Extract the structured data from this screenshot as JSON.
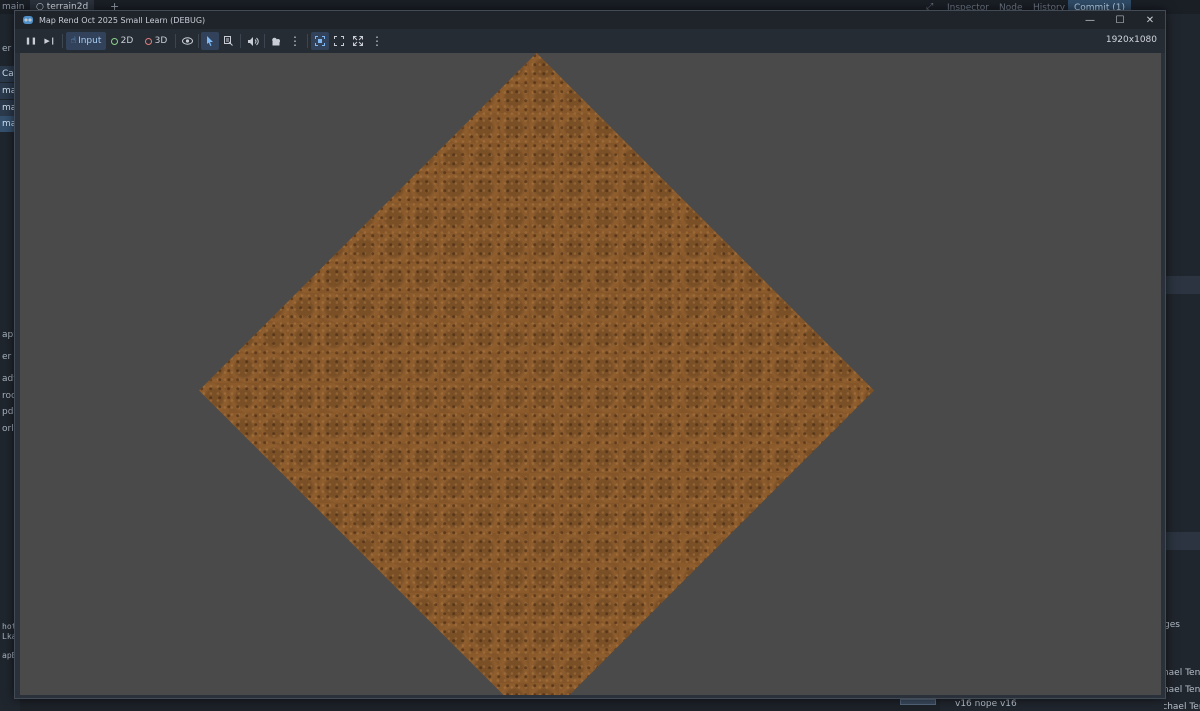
{
  "editor": {
    "tabs": [
      "main",
      "terrain2d"
    ],
    "add_tab": "+",
    "right_tabs": [
      "Inspector",
      "Node",
      "History",
      "Commit (1)"
    ],
    "left_items": [
      "er Si",
      "Can",
      "mai",
      "map",
      "map",
      "apStr",
      "er M",
      "ady",
      "roces",
      "pdat",
      "orld_",
      "hot",
      "Lkan",
      "apBa"
    ],
    "right_items": [
      "ges",
      "chael Ten",
      "chael Ten",
      "Michael Ten"
    ],
    "bottom_text": "v16 nope v16"
  },
  "window": {
    "title": "Map Rend Oct 2025 Small Learn (DEBUG)",
    "controls": {
      "minimize": "—",
      "maximize": "☐",
      "close": "✕"
    }
  },
  "toolbar": {
    "pause": "❚❚",
    "next_frame": "▶❙",
    "input_label": "Input",
    "mode_2d_label": "2D",
    "mode_3d_label": "3D",
    "resolution": "1920x1080"
  },
  "colors": {
    "viewport_bg": "#4a4a4a",
    "terrain": "#8b5a2b",
    "accent": "#31425a"
  }
}
